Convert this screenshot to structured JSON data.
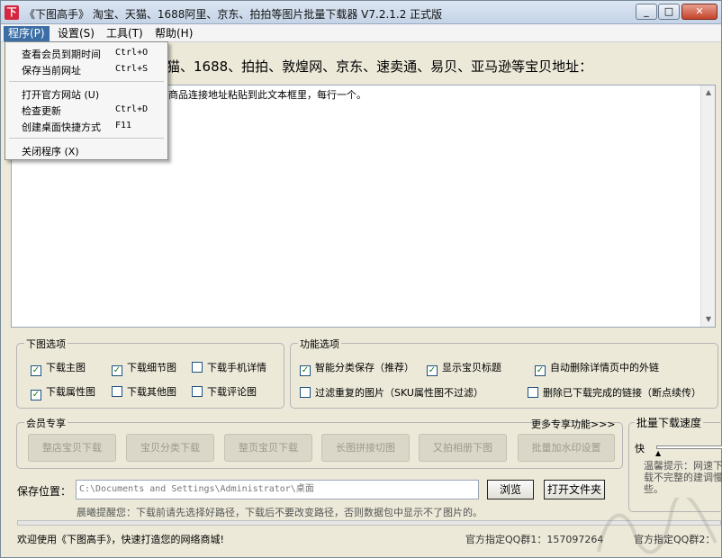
{
  "window": {
    "title": "《下图高手》 淘宝、天猫、1688阿里、京东、拍拍等图片批量下载器 V7.2.1.2 正式版",
    "app_icon": "下"
  },
  "menubar": {
    "items": [
      "程序(P)",
      "设置(S)",
      "工具(T)",
      "帮助(H)"
    ]
  },
  "dropdown": {
    "items": [
      {
        "label": "查看会员到期时间",
        "shortcut": "Ctrl+O"
      },
      {
        "label": "保存当前网址",
        "shortcut": "Ctrl+S"
      },
      {
        "label": "打开官方网站 (U)",
        "shortcut": ""
      },
      {
        "label": "检查更新",
        "shortcut": "Ctrl+D"
      },
      {
        "label": "创建桌面快捷方式",
        "shortcut": "F11"
      },
      {
        "label": "关闭程序 (X)",
        "shortcut": ""
      }
    ]
  },
  "main": {
    "heading": "猫、1688、拍拍、敦煌网、京东、速卖通、易贝、亚马逊等宝贝地址：",
    "textarea_hint": "商品连接地址粘贴到此文本框里，每行一个。"
  },
  "download_options": {
    "title": "下图选项",
    "checkboxes": [
      {
        "label": "下载主图",
        "checked": true
      },
      {
        "label": "下载细节图",
        "checked": true
      },
      {
        "label": "下载手机详情",
        "checked": false
      },
      {
        "label": "下载属性图",
        "checked": true
      },
      {
        "label": "下载其他图",
        "checked": false
      },
      {
        "label": "下载评论图",
        "checked": false
      }
    ]
  },
  "function_options": {
    "title": "功能选项",
    "checkboxes": [
      {
        "label": "智能分类保存（推荐）",
        "checked": true
      },
      {
        "label": "显示宝贝标题",
        "checked": true
      },
      {
        "label": "自动删除详情页中的外链",
        "checked": true
      },
      {
        "label": "过滤重复的图片（SKU属性图不过滤）",
        "checked": false
      },
      {
        "label": "删除已下载完成的链接（断点续传）",
        "checked": false
      }
    ]
  },
  "member": {
    "title": "会员专享",
    "more": "更多专享功能>>>",
    "buttons": [
      "整店宝贝下载",
      "宝贝分类下载",
      "整页宝贝下载",
      "长图拼接切图",
      "又拍相册下图",
      "批量加水印设置"
    ]
  },
  "speed": {
    "title": "批量下载速度",
    "fast_label": "快",
    "tip": "温馨提示：网速下载不完整的建调慢些。"
  },
  "save": {
    "label": "保存位置：",
    "path": "C:\\Documents and Settings\\Administrator\\桌面",
    "browse_label": "浏览",
    "open_folder_label": "打开文件夹",
    "hint": "晨曦提醒您：下载前请先选择好路径，下载后不要改变路径，否则数据包中显示不了图片的。"
  },
  "statusbar": {
    "welcome": "欢迎使用《下图高手》，快速打造您的网络商城!",
    "qq1_label": "官方指定QQ群1：",
    "qq1_number": "157097264",
    "qq2_label": "官方指定QQ群2："
  },
  "colors": {
    "menu_active": "#3a6ea5",
    "check_mark": "#1b7a1b"
  }
}
